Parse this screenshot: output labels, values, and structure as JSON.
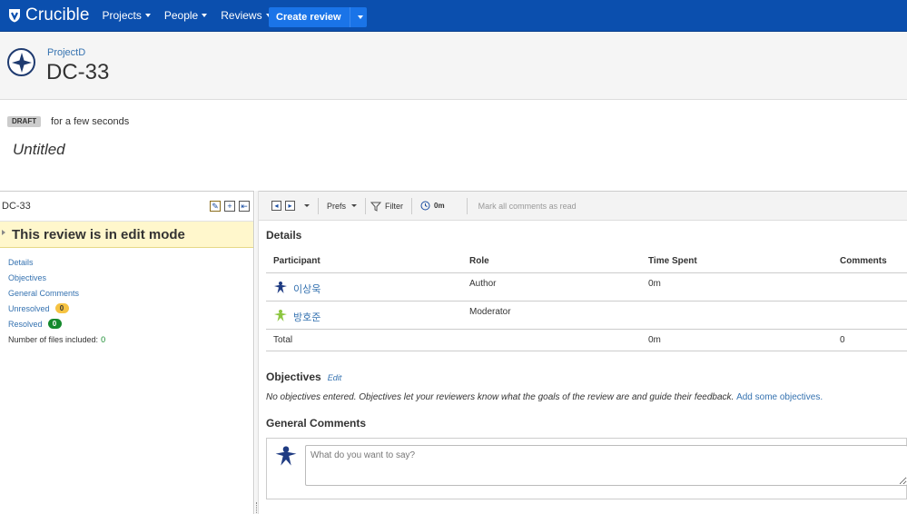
{
  "app": {
    "name": "Crucible"
  },
  "nav": {
    "items": [
      {
        "label": "Projects"
      },
      {
        "label": "People"
      },
      {
        "label": "Reviews"
      }
    ],
    "create_label": "Create review"
  },
  "header": {
    "project": "ProjectD",
    "key": "DC-33"
  },
  "status": {
    "badge": "DRAFT",
    "time": "for a few seconds",
    "title": "Untitled"
  },
  "left_panel": {
    "key": "DC-33",
    "edit_mode_message": "This review is in edit mode",
    "links": {
      "details": "Details",
      "objectives": "Objectives",
      "general_comments": "General Comments",
      "unresolved": "Unresolved",
      "unresolved_count": "0",
      "resolved": "Resolved",
      "resolved_count": "0",
      "files_label": "Number of files included:",
      "files_count": "0"
    }
  },
  "toolbar": {
    "prefs": "Prefs",
    "filter": "Filter",
    "time": "0m",
    "mark_read": "Mark all comments as read"
  },
  "details": {
    "title": "Details",
    "columns": {
      "participant": "Participant",
      "role": "Role",
      "time_spent": "Time Spent",
      "comments": "Comments"
    },
    "rows": [
      {
        "name": "이상욱",
        "role": "Author",
        "time": "0m",
        "comments": "",
        "avatar_color": "#1f3b82"
      },
      {
        "name": "방호준",
        "role": "Moderator",
        "time": "",
        "comments": "",
        "avatar_color": "#8cc63f"
      }
    ],
    "total": {
      "label": "Total",
      "time": "0m",
      "comments": "0"
    }
  },
  "objectives": {
    "title": "Objectives",
    "edit": "Edit",
    "text": "No objectives entered. Objectives let your reviewers know what the goals of the review are and guide their feedback.",
    "add_link": "Add some objectives."
  },
  "general_comments": {
    "title": "General Comments",
    "placeholder": "What do you want to say?"
  },
  "colors": {
    "nav_bg": "#0b4fae",
    "button": "#1a74e8",
    "link": "#3572b0",
    "edit_bar": "#fff7cc"
  }
}
